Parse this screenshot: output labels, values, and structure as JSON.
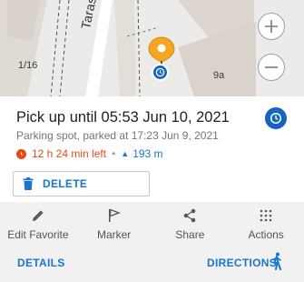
{
  "map": {
    "street_name": "Tarasivska",
    "labels": [
      "1/16",
      "9a"
    ],
    "zoom_in_icon": "plus-icon",
    "zoom_out_icon": "minus-icon"
  },
  "info": {
    "title": "Pick up until 05:53 Jun 10, 2021",
    "subtitle": "Parking spot, parked at 17:23 Jun 9, 2021",
    "time_left": "12 h 24 min left",
    "separator": "•",
    "distance": "193 m",
    "type_icon": "clock-icon"
  },
  "delete_button": {
    "label": "DELETE",
    "icon": "trash-icon"
  },
  "actions": [
    {
      "label": "Edit Favorite",
      "icon": "pencil-icon"
    },
    {
      "label": "Marker",
      "icon": "flag-icon"
    },
    {
      "label": "Share",
      "icon": "share-icon"
    },
    {
      "label": "Actions",
      "icon": "grid-dots-icon"
    }
  ],
  "bottom": {
    "details_label": "DETAILS",
    "directions_label": "DIRECTIONS",
    "directions_icon": "walking-person-icon"
  },
  "colors": {
    "accent": "#1976d2",
    "warning": "#e64a19",
    "pin": "#f5a623",
    "badge": "#1565c0"
  }
}
